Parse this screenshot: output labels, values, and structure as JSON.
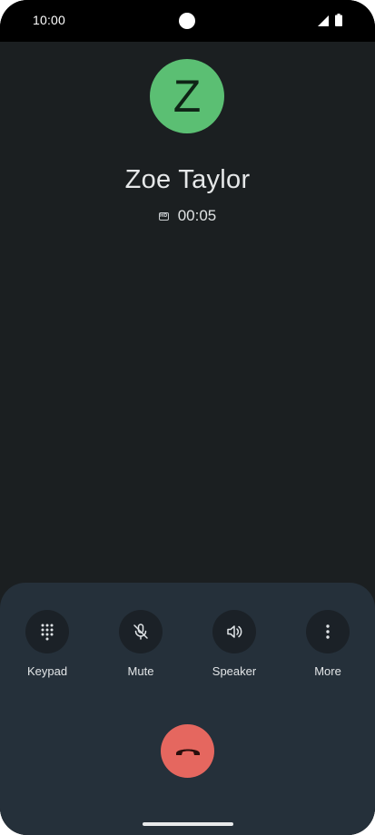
{
  "status_bar": {
    "time": "10:00",
    "icons": [
      "signal-icon",
      "battery-icon"
    ]
  },
  "call": {
    "avatar_letter": "Z",
    "caller_name": "Zoe Taylor",
    "quality_badge": "HD",
    "duration": "00:05"
  },
  "controls": [
    {
      "label": "Keypad",
      "icon": "keypad-icon"
    },
    {
      "label": "Mute",
      "icon": "mute-icon"
    },
    {
      "label": "Speaker",
      "icon": "speaker-icon"
    },
    {
      "label": "More",
      "icon": "more-vert-icon"
    }
  ],
  "end_call": {
    "icon": "end-call-icon"
  },
  "colors": {
    "background": "#1b1f21",
    "avatar": "#5bbf73",
    "control_panel": "#25303a",
    "control_button": "#1b2127",
    "end_call": "#e5675f"
  }
}
